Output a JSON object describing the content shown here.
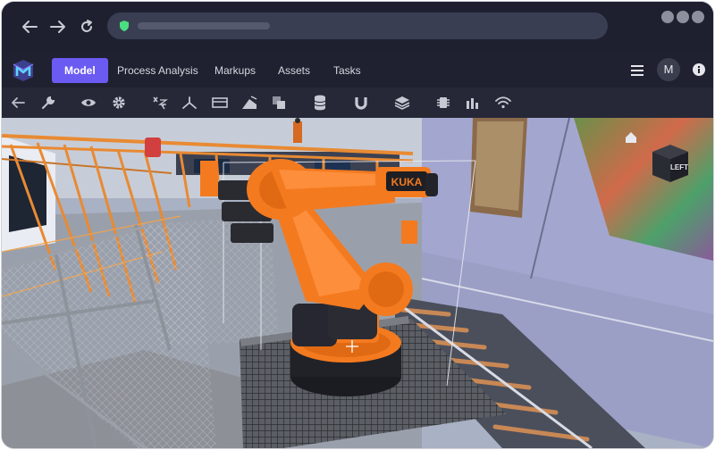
{
  "app": {
    "tabs": [
      {
        "label": "Model",
        "active": true
      },
      {
        "label": "Process Analysis",
        "active": false
      },
      {
        "label": "Markups",
        "active": false
      },
      {
        "label": "Assets",
        "active": false
      },
      {
        "label": "Tasks",
        "active": false
      }
    ],
    "avatar_initial": "M"
  },
  "toolbar": {
    "icons": [
      "back-arrow-icon",
      "wrench-icon",
      "eye-icon",
      "gear-icon",
      "axis-xyz-icon",
      "tripod-icon",
      "section-box-icon",
      "measure-icon",
      "layers-icon",
      "database-icon",
      "magnet-icon",
      "stack-icon",
      "chip-icon",
      "bar-chart-icon",
      "wifi-icon"
    ]
  },
  "viewport": {
    "view_cube_label": "LEFT",
    "robot_brand": "KUKA"
  },
  "colors": {
    "accent": "#6c5bf2",
    "robot": "#f47a1f",
    "url_secure": "#4ade80"
  }
}
